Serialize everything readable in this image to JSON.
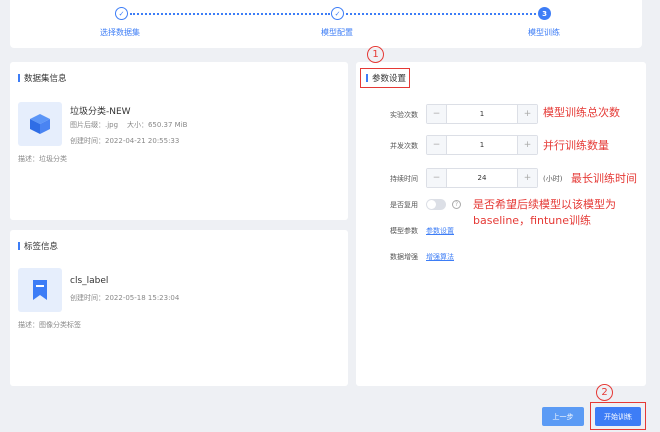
{
  "steps": [
    {
      "label": "选择数据集",
      "status": "done",
      "mark": "✓"
    },
    {
      "label": "模型配置",
      "status": "done",
      "mark": "✓"
    },
    {
      "label": "模型训练",
      "status": "active",
      "mark": "3"
    }
  ],
  "dataset_card": {
    "title": "数据集信息",
    "name": "垃圾分类-NEW",
    "image_suffix_label": "图片后缀：",
    "image_suffix": ".jpg",
    "size_label": "大小：",
    "size": "650.37 MiB",
    "created_label": "创建时间：",
    "created": "2022-04-21 20:55:33",
    "desc_label": "描述：",
    "desc": "垃圾分类",
    "icon": "cube-icon"
  },
  "label_card": {
    "title": "标签信息",
    "name": "cls_label",
    "created_label": "创建时间：",
    "created": "2022-05-18 15:23:04",
    "desc_label": "描述：",
    "desc": "图像分类标签",
    "icon": "bookmark-icon"
  },
  "params": {
    "title": "参数设置",
    "experiments_label": "实验次数",
    "experiments_value": "1",
    "concurrency_label": "并发次数",
    "concurrency_value": "1",
    "duration_label": "持续时间",
    "duration_value": "24",
    "duration_unit": "(小时)",
    "reuse_label": "是否复用",
    "reuse_on": false,
    "model_params_label": "模型参数",
    "model_params_link": "参数设置",
    "augment_label": "数据增强",
    "augment_link": "增强算法",
    "minus": "−",
    "plus": "+",
    "help": "?"
  },
  "annotations": {
    "circle1": "1",
    "circle2": "2",
    "experiments_note": "模型训练总次数",
    "concurrency_note": "并行训练数量",
    "duration_note": "最长训练时间",
    "reuse_note_line1": "是否希望后续模型以该模型为",
    "reuse_note_line2": "baseline，fintune训练"
  },
  "footer": {
    "prev_label": "上一步",
    "start_label": "开始训练"
  },
  "colors": {
    "accent": "#3d7df6",
    "annotation": "#e53935",
    "background": "#eef0f4"
  }
}
